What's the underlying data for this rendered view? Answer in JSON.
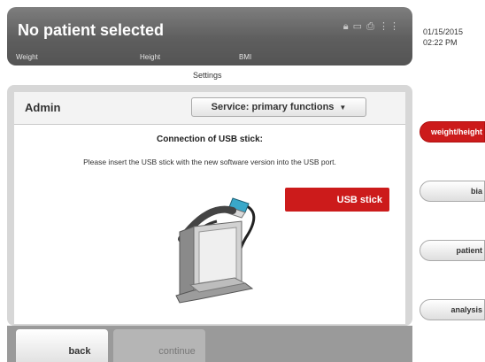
{
  "header": {
    "title": "No patient selected",
    "metrics": [
      "Weight",
      "Height",
      "BMI"
    ],
    "status_icons": [
      "lock-icon",
      "battery-icon",
      "printer-icon",
      "network-icon"
    ]
  },
  "datetime": {
    "date": "01/15/2015",
    "time": "02:22 PM"
  },
  "section_label": "Settings",
  "panel": {
    "title": "Admin",
    "service_dropdown": {
      "selected": "Service: primary functions"
    },
    "connection_title": "Connection of USB stick:",
    "instruction": "Please insert the USB stick with the new software version into the USB port.",
    "usb_label": "USB stick"
  },
  "buttons": {
    "back": "back",
    "continue": "continue"
  },
  "tabs": [
    {
      "label": "weight/height",
      "active": true
    },
    {
      "label": "bia",
      "active": false
    },
    {
      "label": "patient",
      "active": false
    },
    {
      "label": "analysis",
      "active": false
    }
  ],
  "colors": {
    "accent": "#cc1b1b",
    "header": "#5e5e5e"
  }
}
